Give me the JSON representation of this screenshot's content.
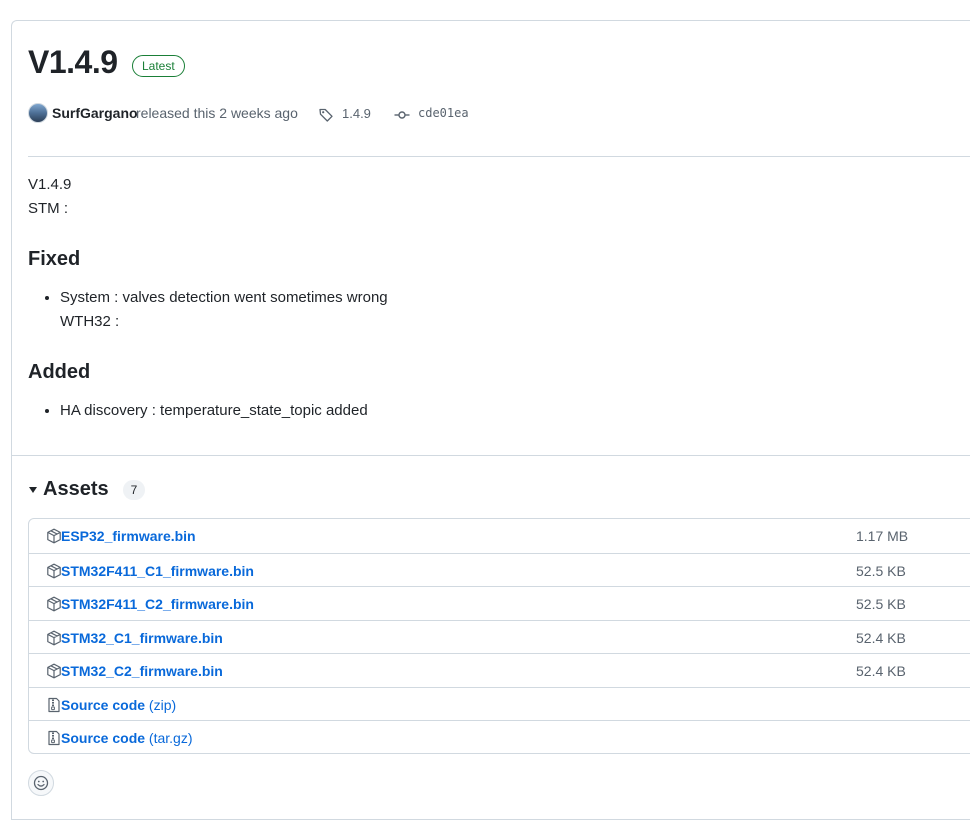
{
  "release": {
    "title": "V1.4.9",
    "badge": "Latest",
    "author": "SurfGargano",
    "released_text": "released this 2 weeks ago",
    "tag": "1.4.9",
    "commit": "cde01ea"
  },
  "notes": {
    "line1": "V1.4.9",
    "line2": "STM :",
    "fixed_heading": "Fixed",
    "fixed_item": "System : valves detection went sometimes wrong",
    "fixed_item_cont": "WTH32 :",
    "added_heading": "Added",
    "added_item": "HA discovery : temperature_state_topic added"
  },
  "assets": {
    "title": "Assets",
    "count": "7",
    "items": [
      {
        "name": "ESP32_firmware.bin",
        "size": "1.17 MB",
        "icon": "package-icon"
      },
      {
        "name": "STM32F411_C1_firmware.bin",
        "size": "52.5 KB",
        "icon": "package-icon"
      },
      {
        "name": "STM32F411_C2_firmware.bin",
        "size": "52.5 KB",
        "icon": "package-icon"
      },
      {
        "name": "STM32_C1_firmware.bin",
        "size": "52.4 KB",
        "icon": "package-icon"
      },
      {
        "name": "STM32_C2_firmware.bin",
        "size": "52.4 KB",
        "icon": "package-icon"
      },
      {
        "name": "Source code",
        "suffix": "(zip)",
        "icon": "file-zip-icon"
      },
      {
        "name": "Source code",
        "suffix": "(tar.gz)",
        "icon": "file-zip-icon"
      }
    ]
  },
  "colors": {
    "link": "#0969da",
    "latest_badge": "#1a7f37",
    "border": "#d1d9e0"
  }
}
